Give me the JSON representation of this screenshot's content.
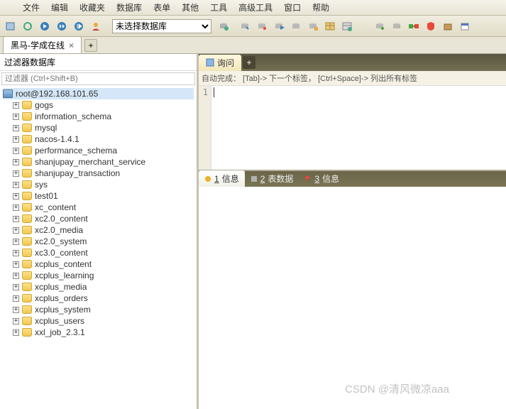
{
  "menu": [
    "文件",
    "编辑",
    "收藏夹",
    "数据库",
    "表单",
    "其他",
    "工具",
    "高级工具",
    "窗口",
    "帮助"
  ],
  "db_select": "未选择数据库",
  "tab_title": "黑马-学成在线",
  "sidebar_title": "过滤器数据库",
  "filter_placeholder": "过滤器 (Ctrl+Shift+B)",
  "root_node": "root@192.168.101.65",
  "databases": [
    "gogs",
    "information_schema",
    "mysql",
    "nacos-1.4.1",
    "performance_schema",
    "shanjupay_merchant_service",
    "shanjupay_transaction",
    "sys",
    "test01",
    "xc_content",
    "xc2.0_content",
    "xc2.0_media",
    "xc2.0_system",
    "xc3.0_content",
    "xcplus_content",
    "xcplus_learning",
    "xcplus_media",
    "xcplus_orders",
    "xcplus_system",
    "xcplus_users",
    "xxl_job_2.3.1"
  ],
  "query_tab": "询问",
  "hint": "自动完成： [Tab]-> 下一个标签， [Ctrl+Space]-> 列出所有标签",
  "gutter_line": "1",
  "result_tabs": [
    {
      "num": "1",
      "label": "信息"
    },
    {
      "num": "2",
      "label": "表数据"
    },
    {
      "num": "3",
      "label": "信息"
    }
  ],
  "watermark": "CSDN @清风微凉aaa",
  "plus": "+",
  "close": "×"
}
